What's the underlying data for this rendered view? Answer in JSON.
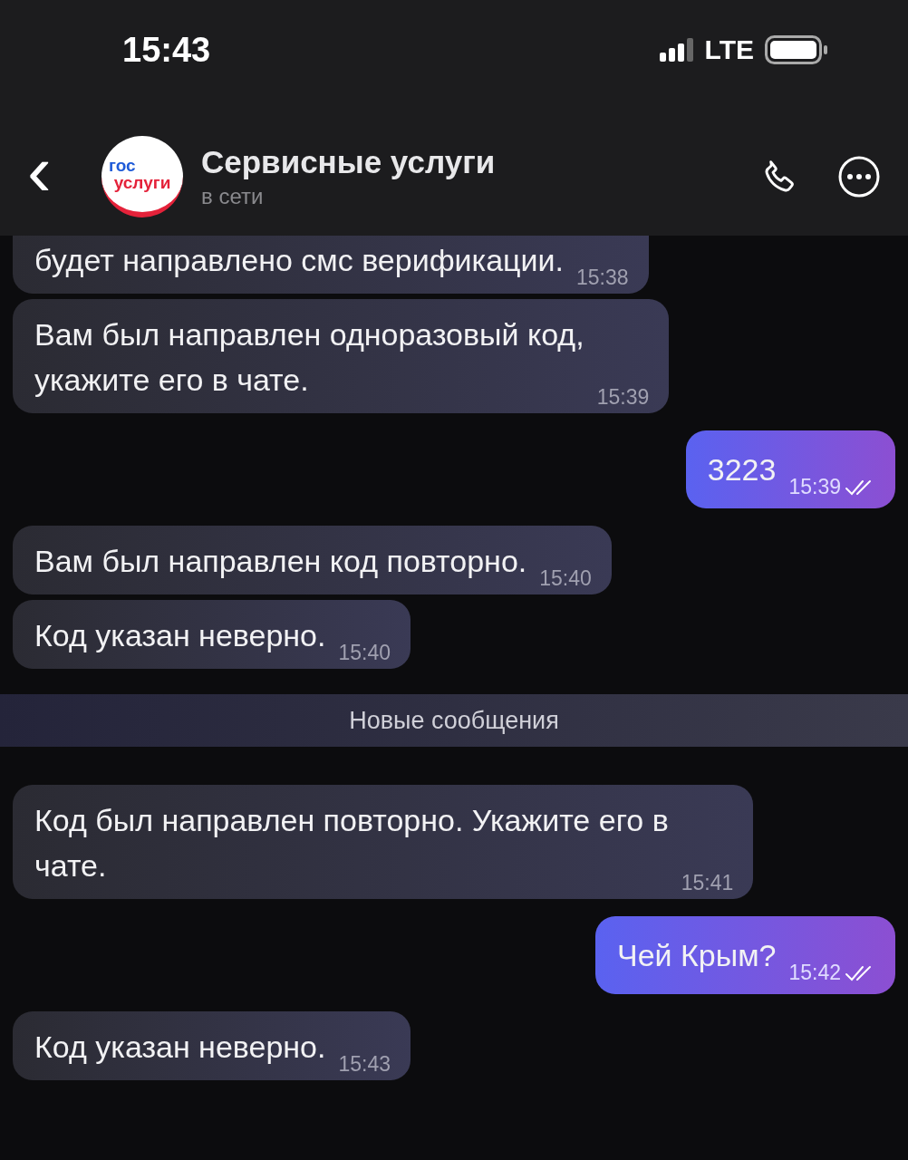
{
  "status_bar": {
    "time": "15:43",
    "network": "LTE"
  },
  "header": {
    "back": "‹",
    "avatar": {
      "line_1": "гос",
      "line_2": "услуги"
    },
    "title": "Сервисные услуги",
    "subtitle": "в сети"
  },
  "messages": [
    {
      "kind": "incoming",
      "text": "будет направлено смс верификации.",
      "time": "15:38",
      "cut_top": true
    },
    {
      "kind": "incoming",
      "text": "Вам был направлен одноразовый код,\nукажите его в чате.",
      "time": "15:39",
      "cut_top": false
    },
    {
      "kind": "outgoing",
      "text": "3223",
      "time": "15:39",
      "read": true
    },
    {
      "kind": "incoming",
      "text": "Вам был направлен код повторно.",
      "time": "15:40",
      "cut_top": false
    },
    {
      "kind": "incoming",
      "text": "Код указан неверно.",
      "time": "15:40",
      "cut_top": false
    },
    {
      "kind": "divider",
      "text": "Новые сообщения"
    },
    {
      "kind": "incoming",
      "text": "Код был направлен повторно. Укажите его в\nчате.",
      "time": "15:41",
      "cut_top": false
    },
    {
      "kind": "outgoing",
      "text": "Чей Крым?",
      "time": "15:42",
      "read": true
    },
    {
      "kind": "incoming",
      "text": "Код указан неверно.",
      "time": "15:43",
      "cut_top": false
    }
  ]
}
